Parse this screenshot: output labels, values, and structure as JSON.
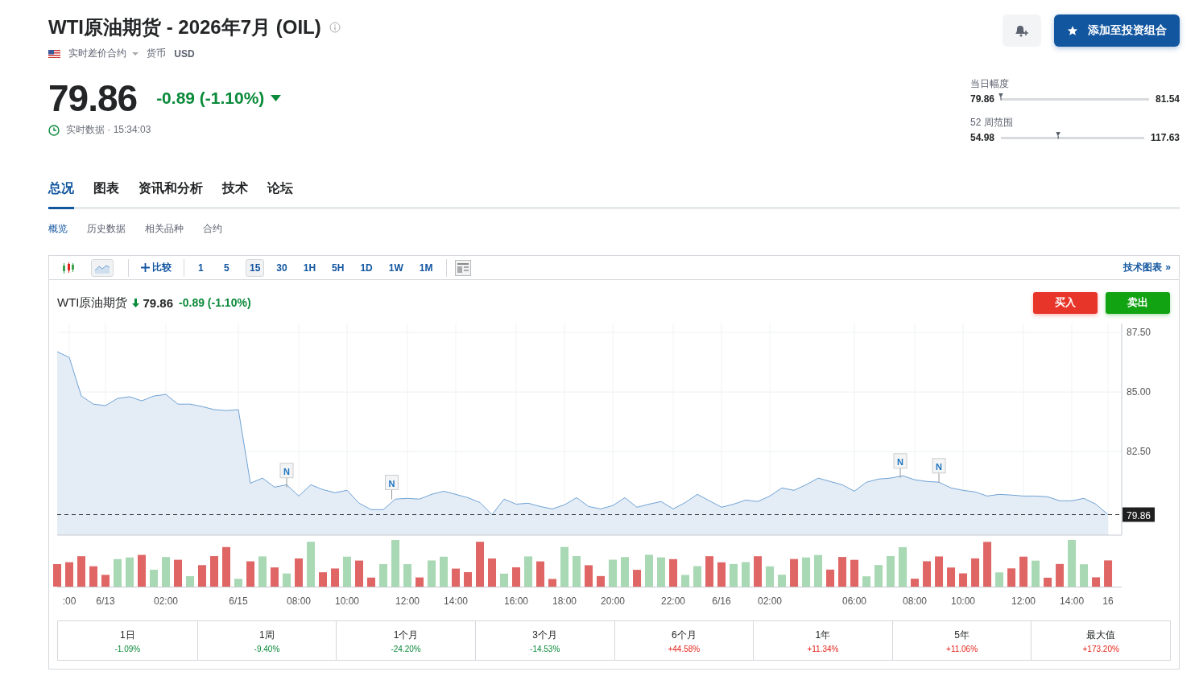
{
  "header": {
    "title": "WTI原油期货 - 2026年7月 (OIL)",
    "contract_type": "实时差价合约",
    "currency_label": "货币",
    "currency": "USD",
    "portfolio_button": {
      "label": "添加至投资组合"
    }
  },
  "quote": {
    "price": "79.86",
    "change": "-0.89",
    "change_pct": "(-1.10%)",
    "status": "实时数据 · 15:34:03"
  },
  "ranges": [
    {
      "label": "当日幅度",
      "low": "79.86",
      "high": "81.54",
      "level": 0.0
    },
    {
      "label": "52 周范围",
      "low": "54.98",
      "high": "117.63",
      "level": 0.4
    }
  ],
  "tabs": [
    {
      "label": "总况",
      "selected": true
    },
    {
      "label": "图表",
      "selected": false
    },
    {
      "label": "资讯和分析",
      "selected": false
    },
    {
      "label": "技术",
      "selected": false
    },
    {
      "label": "论坛",
      "selected": false
    }
  ],
  "subtabs": [
    {
      "label": "概览",
      "selected": true
    },
    {
      "label": "历史数据",
      "selected": false
    },
    {
      "label": "相关品种",
      "selected": false
    },
    {
      "label": "合约",
      "selected": false
    }
  ],
  "chart_toolbar": {
    "chart_types": [
      {
        "kind": "candles",
        "selected": false
      },
      {
        "kind": "area",
        "selected": true
      }
    ],
    "compare": "比较",
    "intervals": [
      {
        "label": "1",
        "selected": false
      },
      {
        "label": "5",
        "selected": false
      },
      {
        "label": "15",
        "selected": true
      },
      {
        "label": "30",
        "selected": false
      },
      {
        "label": "1H",
        "selected": false
      },
      {
        "label": "5H",
        "selected": false
      },
      {
        "label": "1D",
        "selected": false
      },
      {
        "label": "1W",
        "selected": false
      },
      {
        "label": "1M",
        "selected": false
      }
    ],
    "advanced_link": "技术图表",
    "advanced_arrow": "»"
  },
  "chart_header": {
    "name": "WTI原油期货",
    "price": "79.86",
    "change": "-0.89",
    "change_pct": "(-1.10%)",
    "buy": "买入",
    "sell": "卖出"
  },
  "chart": {
    "chart_data": {
      "type": "area",
      "ylim": [
        79.0,
        87.87
      ],
      "grid": true,
      "yticks": [
        {
          "value": 82.5,
          "label": "82.50"
        },
        {
          "value": 85,
          "label": "85.00"
        },
        {
          "value": 87.5,
          "label": "87.50"
        }
      ],
      "categories": [
        null,
        ":00",
        null,
        null,
        "6/13",
        null,
        null,
        null,
        null,
        "02:00",
        null,
        null,
        null,
        null,
        null,
        "6/15",
        null,
        null,
        null,
        null,
        "08:00",
        null,
        null,
        null,
        "10:00",
        null,
        null,
        null,
        null,
        "12:00",
        null,
        null,
        null,
        "14:00",
        null,
        null,
        null,
        null,
        "16:00",
        null,
        null,
        null,
        "18:00",
        null,
        null,
        null,
        "20:00",
        null,
        null,
        null,
        null,
        "22:00",
        null,
        null,
        null,
        "6/16",
        null,
        null,
        null,
        "02:00",
        null,
        null,
        null,
        null,
        null,
        null,
        "06:00",
        null,
        null,
        null,
        null,
        "08:00",
        null,
        null,
        null,
        "10:00",
        null,
        null,
        null,
        null,
        "12:00",
        null,
        null,
        null,
        "14:00",
        null,
        null,
        "16"
      ],
      "series": [
        {
          "color": "#6fa3d6",
          "values": [
            86.69,
            86.45,
            84.83,
            84.49,
            84.43,
            84.73,
            84.8,
            84.63,
            84.83,
            84.9,
            84.49,
            84.49,
            84.39,
            84.26,
            84.22,
            84.26,
            81.18,
            81.39,
            81.01,
            81.11,
            80.64,
            81.11,
            80.91,
            80.78,
            80.88,
            80.34,
            80.07,
            80.07,
            80.51,
            80.54,
            80.51,
            80.71,
            80.84,
            80.71,
            80.57,
            80.37,
            79.86,
            80.51,
            80.3,
            80.34,
            80.2,
            80.1,
            80.27,
            80.57,
            80.2,
            80.1,
            80.24,
            80.57,
            80.17,
            80.3,
            80.41,
            80.1,
            80.37,
            80.71,
            80.44,
            80.17,
            80.3,
            80.47,
            80.41,
            80.64,
            80.98,
            80.88,
            81.11,
            81.39,
            81.25,
            81.11,
            80.84,
            81.22,
            81.35,
            81.39,
            81.49,
            81.32,
            81.25,
            81.22,
            80.98,
            80.88,
            80.81,
            80.64,
            80.71,
            80.68,
            80.64,
            80.64,
            80.61,
            80.44,
            80.44,
            80.54,
            80.3,
            79.86
          ]
        }
      ],
      "annotations": [
        {
          "y": 81.0,
          "text": "N"
        },
        {
          "y": 80.5,
          "text": "N"
        },
        {
          "y": 81.4,
          "text": "N"
        },
        {
          "y": 81.2,
          "text": "N"
        }
      ],
      "ref_lines": [
        {
          "axis": "y",
          "value": 79.86,
          "label": "79.86"
        }
      ]
    }
  },
  "performance": [
    {
      "period": "1日",
      "change": "-1.09%"
    },
    {
      "period": "1周",
      "change": "-9.40%"
    },
    {
      "period": "1个月",
      "change": "-24.20%"
    },
    {
      "period": "3个月",
      "change": "-14.53%"
    },
    {
      "period": "6个月",
      "change": "+44.58%"
    },
    {
      "period": "1年",
      "change": "+11.34%"
    },
    {
      "period": "5年",
      "change": "+11.06%"
    },
    {
      "period": "最大值",
      "change": "+173.20%"
    }
  ]
}
